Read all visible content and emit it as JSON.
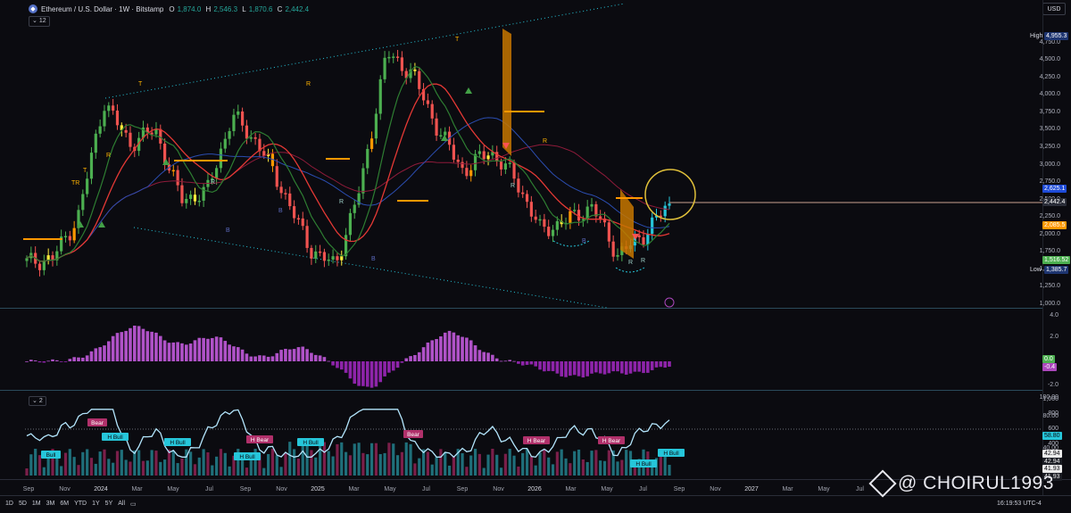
{
  "header": {
    "symbol_title": "Ethereum / U.S. Dollar · 1W · Bitstamp",
    "ohlc": [
      {
        "k": "O",
        "v": "1,874.0"
      },
      {
        "k": "H",
        "v": "2,546.3"
      },
      {
        "k": "L",
        "v": "1,870.6"
      },
      {
        "k": "C",
        "v": "2,442.4"
      }
    ],
    "indicator_count": "12",
    "currency": "USD"
  },
  "colors": {
    "bg": "#0b0b10",
    "up": "#4caf50",
    "down": "#ef5350",
    "teal": "#26c6da",
    "purple": "#ab47bc",
    "orange": "#ff9800",
    "red_ma": "#e53935",
    "blue_ma": "#1e3a8a",
    "green_ma": "#2e7d32"
  },
  "price_axis": {
    "ticks": [
      "4,750.0",
      "4,500.0",
      "4,250.0",
      "4,000.0",
      "3,750.0",
      "3,500.0",
      "3,250.0",
      "3,000.0",
      "2,750.0",
      "2,500.0",
      "2,250.0",
      "2,000.0",
      "1,750.0",
      "1,500.0",
      "1,250.0",
      "1,000.0"
    ],
    "high_label": "High",
    "high_value": "4,955.3",
    "low_label": "Low",
    "low_value": "1,385.7",
    "tags": [
      {
        "value": "2,625.1",
        "color": "#1e4bd8"
      },
      {
        "value": "2,442.4",
        "color": "#2a2d38"
      },
      {
        "value": "2,085.5",
        "color": "#ff9800"
      },
      {
        "value": "1,516.52",
        "color": "#4caf50"
      }
    ]
  },
  "macd_axis": {
    "ticks": [
      "4.0",
      "2.0",
      "0.0",
      "-2.0"
    ],
    "tags": [
      {
        "value": "0.0",
        "color": "#4caf50"
      },
      {
        "value": "-0.4",
        "color": "#ab47bc"
      }
    ]
  },
  "rsi_panel": {
    "badge": "2",
    "left_ticks": [
      "1,000",
      "800",
      "600",
      "400",
      "200",
      "0"
    ],
    "right_ticks": [
      "100.00",
      "80.00",
      "58.80",
      "40.00"
    ],
    "values": [
      "42.94",
      "42.94",
      "41.93",
      "41.93"
    ],
    "signals": [
      "Bull",
      "Bear",
      "H Bull",
      "H Bull",
      "H Bull",
      "H Bear",
      "H Bull",
      "Bear",
      "H Bear",
      "H Bear",
      "H Bull",
      "H Bull"
    ]
  },
  "chart_markers": {
    "top": [
      "T",
      "R",
      "T",
      "TR",
      "R",
      "T",
      "R"
    ],
    "bottom": [
      "R",
      "B",
      "B",
      "R",
      "B",
      "R",
      "B",
      "R",
      "R"
    ]
  },
  "time_axis": [
    "Sep",
    "Nov",
    "2024",
    "Mar",
    "May",
    "Jul",
    "Sep",
    "Nov",
    "2025",
    "Mar",
    "May",
    "Jul",
    "Sep",
    "Nov",
    "2026",
    "Mar",
    "May",
    "Jul",
    "Sep",
    "Nov",
    "2027",
    "Mar",
    "May",
    "Jul"
  ],
  "timeframes": [
    "1D",
    "5D",
    "1M",
    "3M",
    "6M",
    "YTD",
    "1Y",
    "5Y",
    "All"
  ],
  "clock": "16:19:53 UTC-4",
  "watermark": "@ CHOIRUL1993",
  "chart_data": {
    "type": "candlestick",
    "symbol": "Ethereum / U.S. Dollar",
    "interval": "1W",
    "exchange": "Bitstamp",
    "ylim": [
      1000,
      5000
    ],
    "x": [
      "Sep",
      "Nov",
      "2024",
      "Mar",
      "May",
      "Jul",
      "Sep",
      "Nov",
      "2025",
      "Mar",
      "May",
      "Jul",
      "Sep",
      "Nov",
      "2026",
      "Mar",
      "May",
      "Jul"
    ],
    "close_path": [
      1600,
      1650,
      2250,
      3900,
      3300,
      3500,
      2500,
      2600,
      3700,
      3300,
      2600,
      1800,
      1550,
      2700,
      4600,
      4300,
      3500,
      2900,
      3200,
      2800,
      2050,
      2200,
      2400,
      1700,
      2000,
      2442
    ],
    "last": {
      "open": 1874.0,
      "high": 2546.3,
      "low": 1870.6,
      "close": 2442.4
    }
  }
}
